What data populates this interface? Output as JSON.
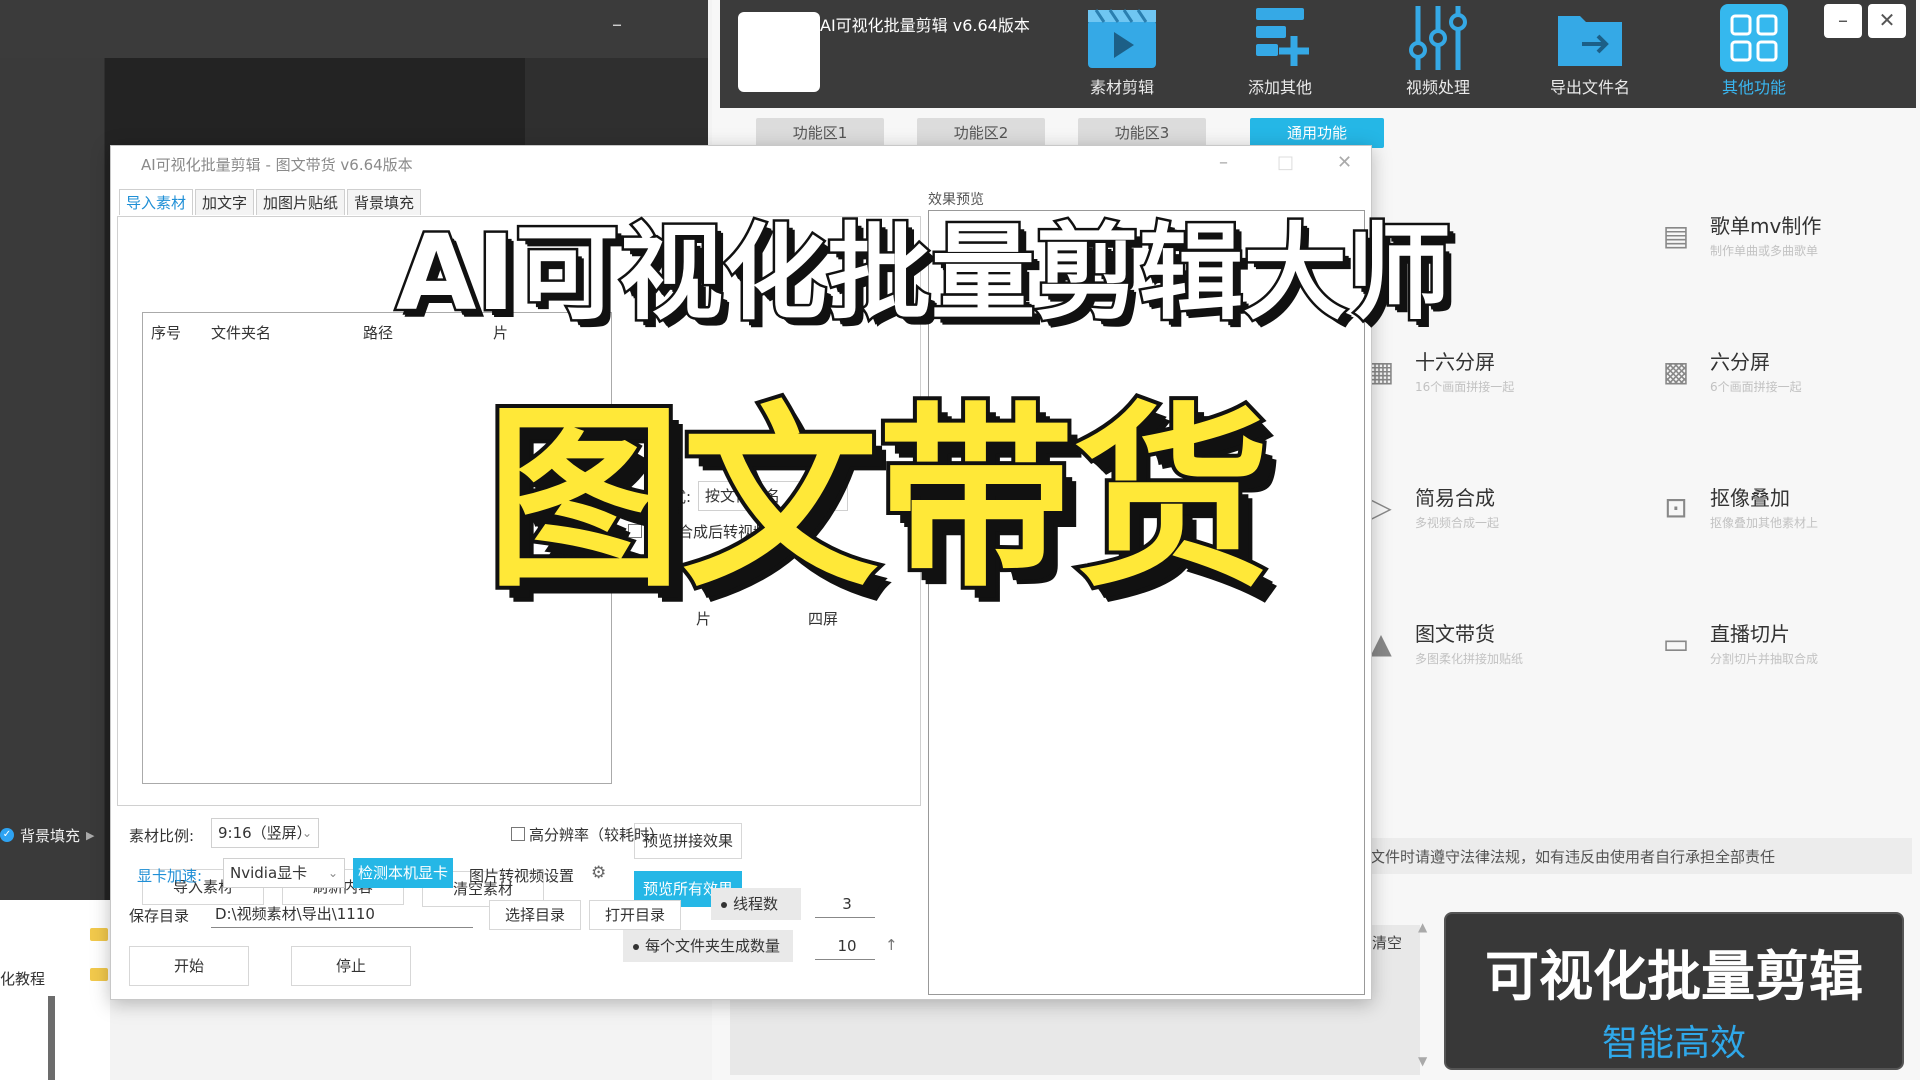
{
  "background_left": {
    "fill_item_label": "背景填充",
    "tutorial_text": "化教程"
  },
  "background_app": {
    "title": "AI可视化批量剪辑 v6.64版本",
    "toolbar": [
      {
        "label": "素材剪辑",
        "icon": "film-clapper-icon"
      },
      {
        "label": "添加其他",
        "icon": "add-layers-icon"
      },
      {
        "label": "视频处理",
        "icon": "sliders-icon"
      },
      {
        "label": "导出文件名",
        "icon": "export-folder-icon"
      },
      {
        "label": "其他功能",
        "icon": "grid-apps-icon",
        "active": true
      }
    ],
    "window_buttons": {
      "minimize": "–",
      "close": "✕"
    },
    "area_tabs": [
      {
        "label": "功能区1"
      },
      {
        "label": "功能区2"
      },
      {
        "label": "功能区3"
      },
      {
        "label": "通用功能",
        "active": true
      }
    ],
    "features": [
      {
        "name": "歌单mv制作",
        "desc": "制作单曲或多曲歌单",
        "icon": "music-list-icon"
      },
      {
        "name": "十六分屏",
        "desc": "16个画面拼接一起",
        "icon": "grid-16-icon"
      },
      {
        "name": "六分屏",
        "desc": "6个画面拼接一起",
        "icon": "grid-6-icon"
      },
      {
        "name": "简易合成",
        "desc": "多视频合成一起",
        "icon": "video-merge-icon"
      },
      {
        "name": "抠像叠加",
        "desc": "抠像叠加其他素材上",
        "icon": "portrait-cutout-icon"
      },
      {
        "name": "图文带货",
        "desc": "多图柔化拼接加贴纸",
        "icon": "image-text-icon"
      },
      {
        "name": "直播切片",
        "desc": "分割切片并抽取合成",
        "icon": "live-camera-icon"
      }
    ],
    "law_notice": "文件时请遵守法律法规，如有违反由使用者自行承担全部责任",
    "clear_label": "清空"
  },
  "dialog": {
    "title": "AI可视化批量剪辑 - 图文带货 v6.64版本",
    "controls": {
      "minimize": "–",
      "maximize": "□",
      "close": "✕"
    },
    "tabs": [
      {
        "label": "导入素材",
        "active": true
      },
      {
        "label": "加文字"
      },
      {
        "label": "加图片贴纸"
      },
      {
        "label": "背景填充"
      }
    ],
    "file_list": {
      "columns": [
        "序号",
        "文件夹名",
        "路径",
        "片"
      ]
    },
    "extract_mode_label": "抽取模式:",
    "extract_mode_value": "按文件夹名",
    "image_to_video_label": "图片合成后转视频",
    "fragment_a": "片",
    "fragment_b": "四屏",
    "preview_splice_button": "预览拼接效果",
    "preview_all_button": "预览所有效果",
    "import_button": "导入素材",
    "refresh_button": "刷新内容",
    "clear_button": "清空素材",
    "ratio_label": "素材比例:",
    "ratio_value": "9:16（竖屏）",
    "high_res_label": "高分辨率（较耗时）",
    "gpu_label": "显卡加速:",
    "gpu_value": "Nvidia显卡",
    "detect_gpu_button": "检测本机显卡",
    "img_to_video_settings": "图片转视频设置",
    "save_dir_label": "保存目录",
    "save_dir_value": "D:\\视频素材\\导出\\1110",
    "choose_dir_button": "选择目录",
    "open_dir_button": "打开目录",
    "threads_label": "线程数",
    "threads_value": "3",
    "per_folder_label": "每个文件夹生成数量",
    "per_folder_value": "10",
    "start_button": "开始",
    "stop_button": "停止",
    "preview_label": "效果预览"
  },
  "overlay": {
    "title": "AI可视化批量剪辑大师",
    "subtitle": "图文带货"
  },
  "promo": {
    "main": "可视化批量剪辑",
    "sub": "智能高效"
  },
  "colors": {
    "accent": "#25b7e6",
    "subtitle_yellow": "#ffe838",
    "promo_blue": "#2fa8ea",
    "dark_bg": "#3b3b3b"
  }
}
